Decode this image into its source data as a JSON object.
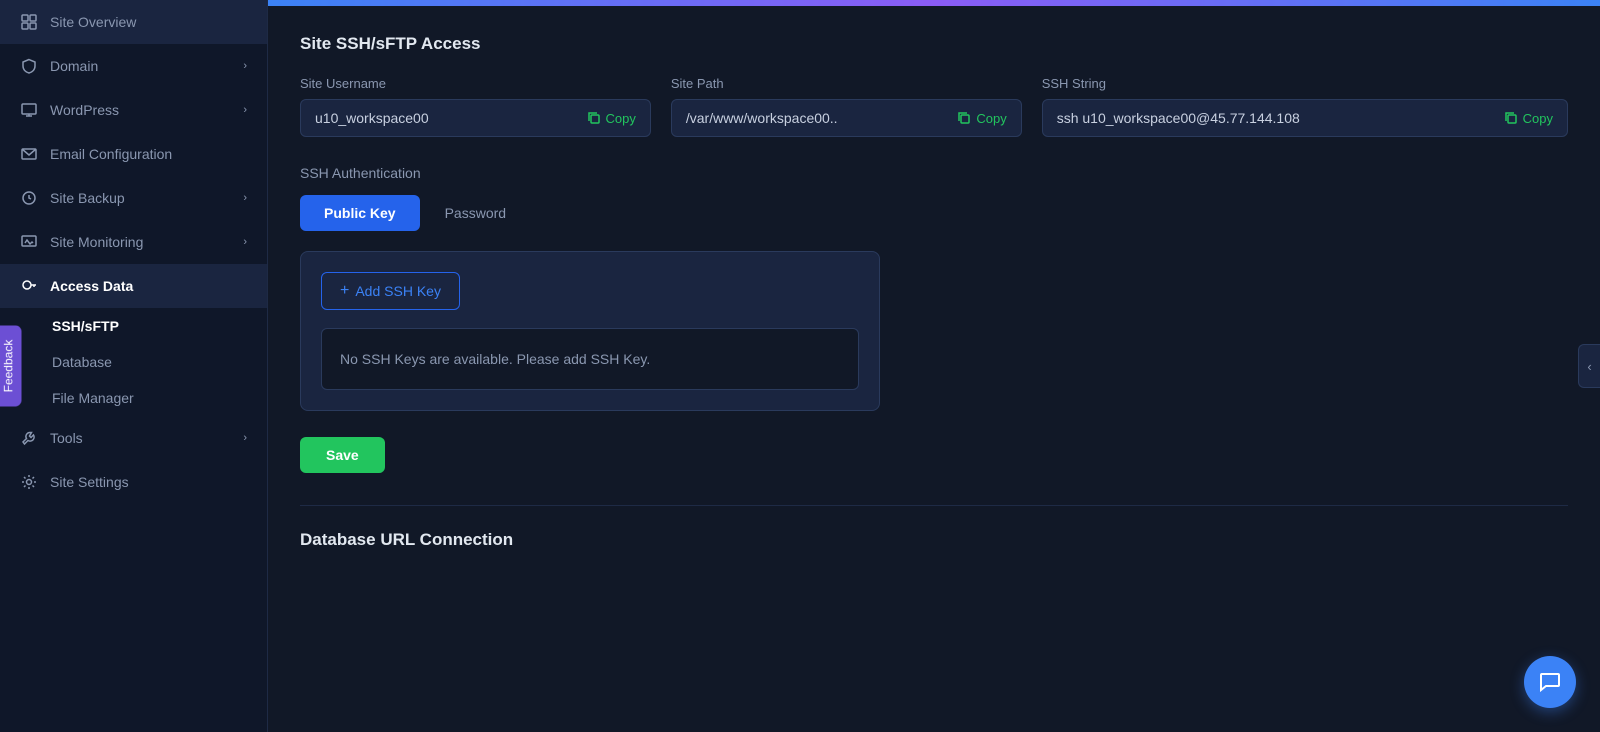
{
  "sidebar": {
    "items": [
      {
        "id": "site-overview",
        "label": "Site Overview",
        "icon": "grid",
        "hasChevron": false
      },
      {
        "id": "domain",
        "label": "Domain",
        "icon": "shield",
        "hasChevron": true
      },
      {
        "id": "wordpress",
        "label": "WordPress",
        "icon": "monitor",
        "hasChevron": true
      },
      {
        "id": "email-config",
        "label": "Email Configuration",
        "icon": "mail",
        "hasChevron": false
      },
      {
        "id": "site-backup",
        "label": "Site Backup",
        "icon": "settings",
        "hasChevron": true
      },
      {
        "id": "site-monitoring",
        "label": "Site Monitoring",
        "icon": "monitor2",
        "hasChevron": true
      },
      {
        "id": "access-data",
        "label": "Access Data",
        "icon": "key",
        "hasChevron": false,
        "active": true
      }
    ],
    "subitems": [
      {
        "id": "ssh-sftp",
        "label": "SSH/sFTP",
        "active": true
      },
      {
        "id": "database",
        "label": "Database"
      },
      {
        "id": "file-manager",
        "label": "File Manager"
      }
    ],
    "bottom_items": [
      {
        "id": "tools",
        "label": "Tools",
        "icon": "tool",
        "hasChevron": true
      },
      {
        "id": "site-settings",
        "label": "Site Settings",
        "icon": "gear",
        "hasChevron": false
      }
    ]
  },
  "main": {
    "section_title": "Site SSH/sFTP Access",
    "site_username_label": "Site Username",
    "site_username_value": "u10_workspace00",
    "site_path_label": "Site Path",
    "site_path_value": "/var/www/workspace00..",
    "ssh_string_label": "SSH String",
    "ssh_string_value": "ssh u10_workspace00@45.77.144.108",
    "copy_label": "Copy",
    "ssh_auth_label": "SSH Authentication",
    "auth_tabs": [
      {
        "id": "public-key",
        "label": "Public Key",
        "active": true
      },
      {
        "id": "password",
        "label": "Password",
        "active": false
      }
    ],
    "add_ssh_key_label": "+ Add SSH Key",
    "no_keys_message": "No SSH Keys are available. Please add SSH Key.",
    "save_label": "Save",
    "db_section_title": "Database URL Connection"
  },
  "feedback": {
    "label": "Feedback"
  },
  "chat": {
    "icon": "chat-icon"
  }
}
